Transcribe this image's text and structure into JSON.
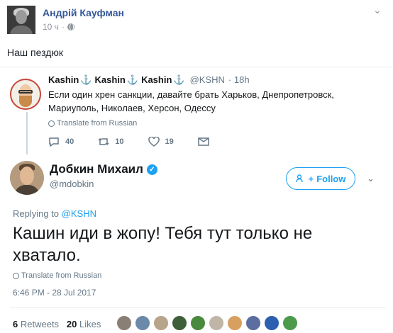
{
  "post": {
    "author": "Андрій Кауфман",
    "time": "10 ч",
    "dot": "·",
    "more": "⌄",
    "text": "Наш пездюк"
  },
  "quoted_tweet": {
    "name": "Kashin",
    "anchor": "⚓",
    "handle": "@KSHN",
    "time": "· 18h",
    "text": "Если один хрен санкции, давайте брать Харьков, Днепропетровск, Мариуполь, Николаев, Херсон, Одессу",
    "translate_label": "Translate from Russian",
    "replies": "40",
    "retweets": "10",
    "likes": "19"
  },
  "tweet": {
    "name": "Добкин Михаил",
    "verified_mark": "✓",
    "handle": "@mdobkin",
    "follow_label": "Follow",
    "follow_icon": "+",
    "chevron": "⌄",
    "replying_label": "Replying to",
    "replying_handle": "@KSHN",
    "text": "Кашин иди в жопу! Тебя тут только не хватало.",
    "translate_label": "Translate from Russian",
    "date": "6:46 PM - 28 Jul 2017",
    "retweets_count": "6",
    "retweets_label": "Retweets",
    "likes_count": "20",
    "likes_label": "Likes"
  },
  "liker_colors": [
    "#8a7f74",
    "#6b89a8",
    "#b8a48a",
    "#3f5e3a",
    "#4a8a3c",
    "#c0b6a8",
    "#d8a060",
    "#5c6ea0",
    "#2d5fb0",
    "#4c9a4c"
  ],
  "colors": {
    "facebook_link": "#365899",
    "twitter_blue": "#1da1f2",
    "muted": "#657786"
  }
}
